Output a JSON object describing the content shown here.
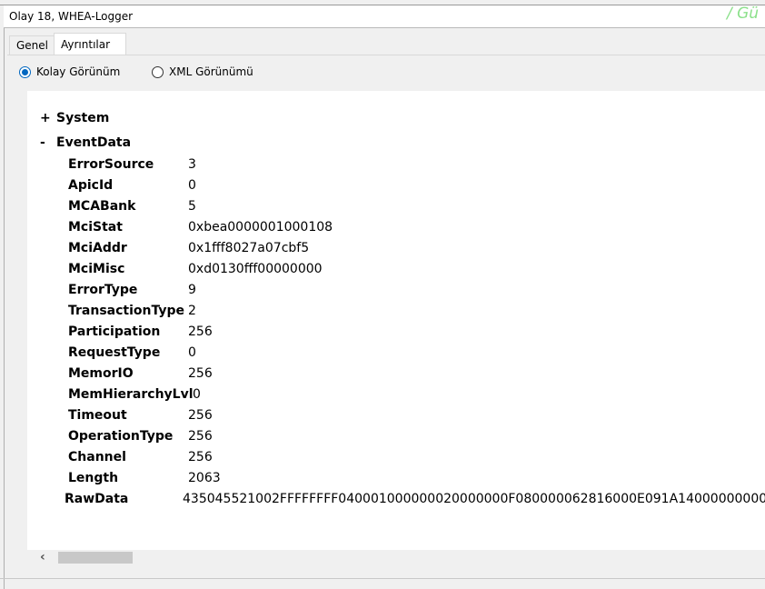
{
  "window": {
    "title": "Olay 18, WHEA-Logger",
    "scribble": "/ Gü"
  },
  "tabs": [
    {
      "label": "Genel"
    },
    {
      "label": "Ayrıntılar"
    }
  ],
  "views": {
    "friendly": "Kolay Görünüm",
    "xml": "XML Görünümü",
    "selected": "friendly"
  },
  "tree": {
    "system": {
      "sign": "+",
      "label": "System"
    },
    "eventdata": {
      "sign": "-",
      "label": "EventData"
    }
  },
  "fields": [
    {
      "key": "ErrorSource",
      "value": "3"
    },
    {
      "key": "ApicId",
      "value": "0"
    },
    {
      "key": "MCABank",
      "value": "5"
    },
    {
      "key": "MciStat",
      "value": "0xbea0000001000108"
    },
    {
      "key": "MciAddr",
      "value": "0x1fff8027a07cbf5"
    },
    {
      "key": "MciMisc",
      "value": "0xd0130fff00000000"
    },
    {
      "key": "ErrorType",
      "value": "9"
    },
    {
      "key": "TransactionType",
      "value": "2"
    },
    {
      "key": "Participation",
      "value": "256"
    },
    {
      "key": "RequestType",
      "value": "0"
    },
    {
      "key": "MemorIO",
      "value": "256"
    },
    {
      "key": "MemHierarchyLvl",
      "value": "0"
    },
    {
      "key": "Timeout",
      "value": "256"
    },
    {
      "key": "OperationType",
      "value": "256"
    },
    {
      "key": "Channel",
      "value": "256"
    },
    {
      "key": "Length",
      "value": "2063"
    }
  ],
  "rawdata": {
    "key": "RawData",
    "value": "435045521002FFFFFFFF040001000000020000000F080000062816000E091A14000000000"
  }
}
